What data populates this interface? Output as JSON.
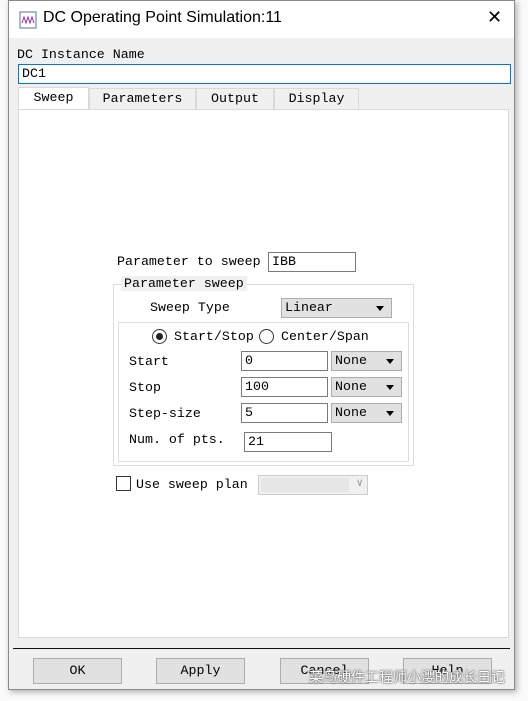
{
  "window": {
    "title": "DC Operating Point Simulation:11",
    "icon": "simulation-icon"
  },
  "instance": {
    "label": "DC Instance Name",
    "value": "DC1"
  },
  "tabs": [
    {
      "label": "Sweep",
      "active": true
    },
    {
      "label": "Parameters"
    },
    {
      "label": "Output"
    },
    {
      "label": "Display"
    }
  ],
  "sweep": {
    "param_label": "Parameter to sweep",
    "param_value": "IBB",
    "group_title": "Parameter sweep",
    "type_label": "Sweep Type",
    "type_value": "Linear",
    "radio_start_stop": "Start/Stop",
    "radio_center_span": "Center/Span",
    "selected": "Start/Stop",
    "rows": [
      {
        "label": "Start",
        "value": "0",
        "unit": "None"
      },
      {
        "label": "Stop",
        "value": "100",
        "unit": "None"
      },
      {
        "label": "Step-size",
        "value": "5",
        "unit": "None"
      }
    ],
    "npts_label": "Num. of pts.",
    "npts_value": "21",
    "plan_label": "Use sweep plan",
    "plan_checked": false
  },
  "buttons": {
    "ok": "OK",
    "apply": "Apply",
    "cancel": "Cancel",
    "help": "Help"
  },
  "watermark": "菜鸟硬件工程师小瀴的成长日记"
}
